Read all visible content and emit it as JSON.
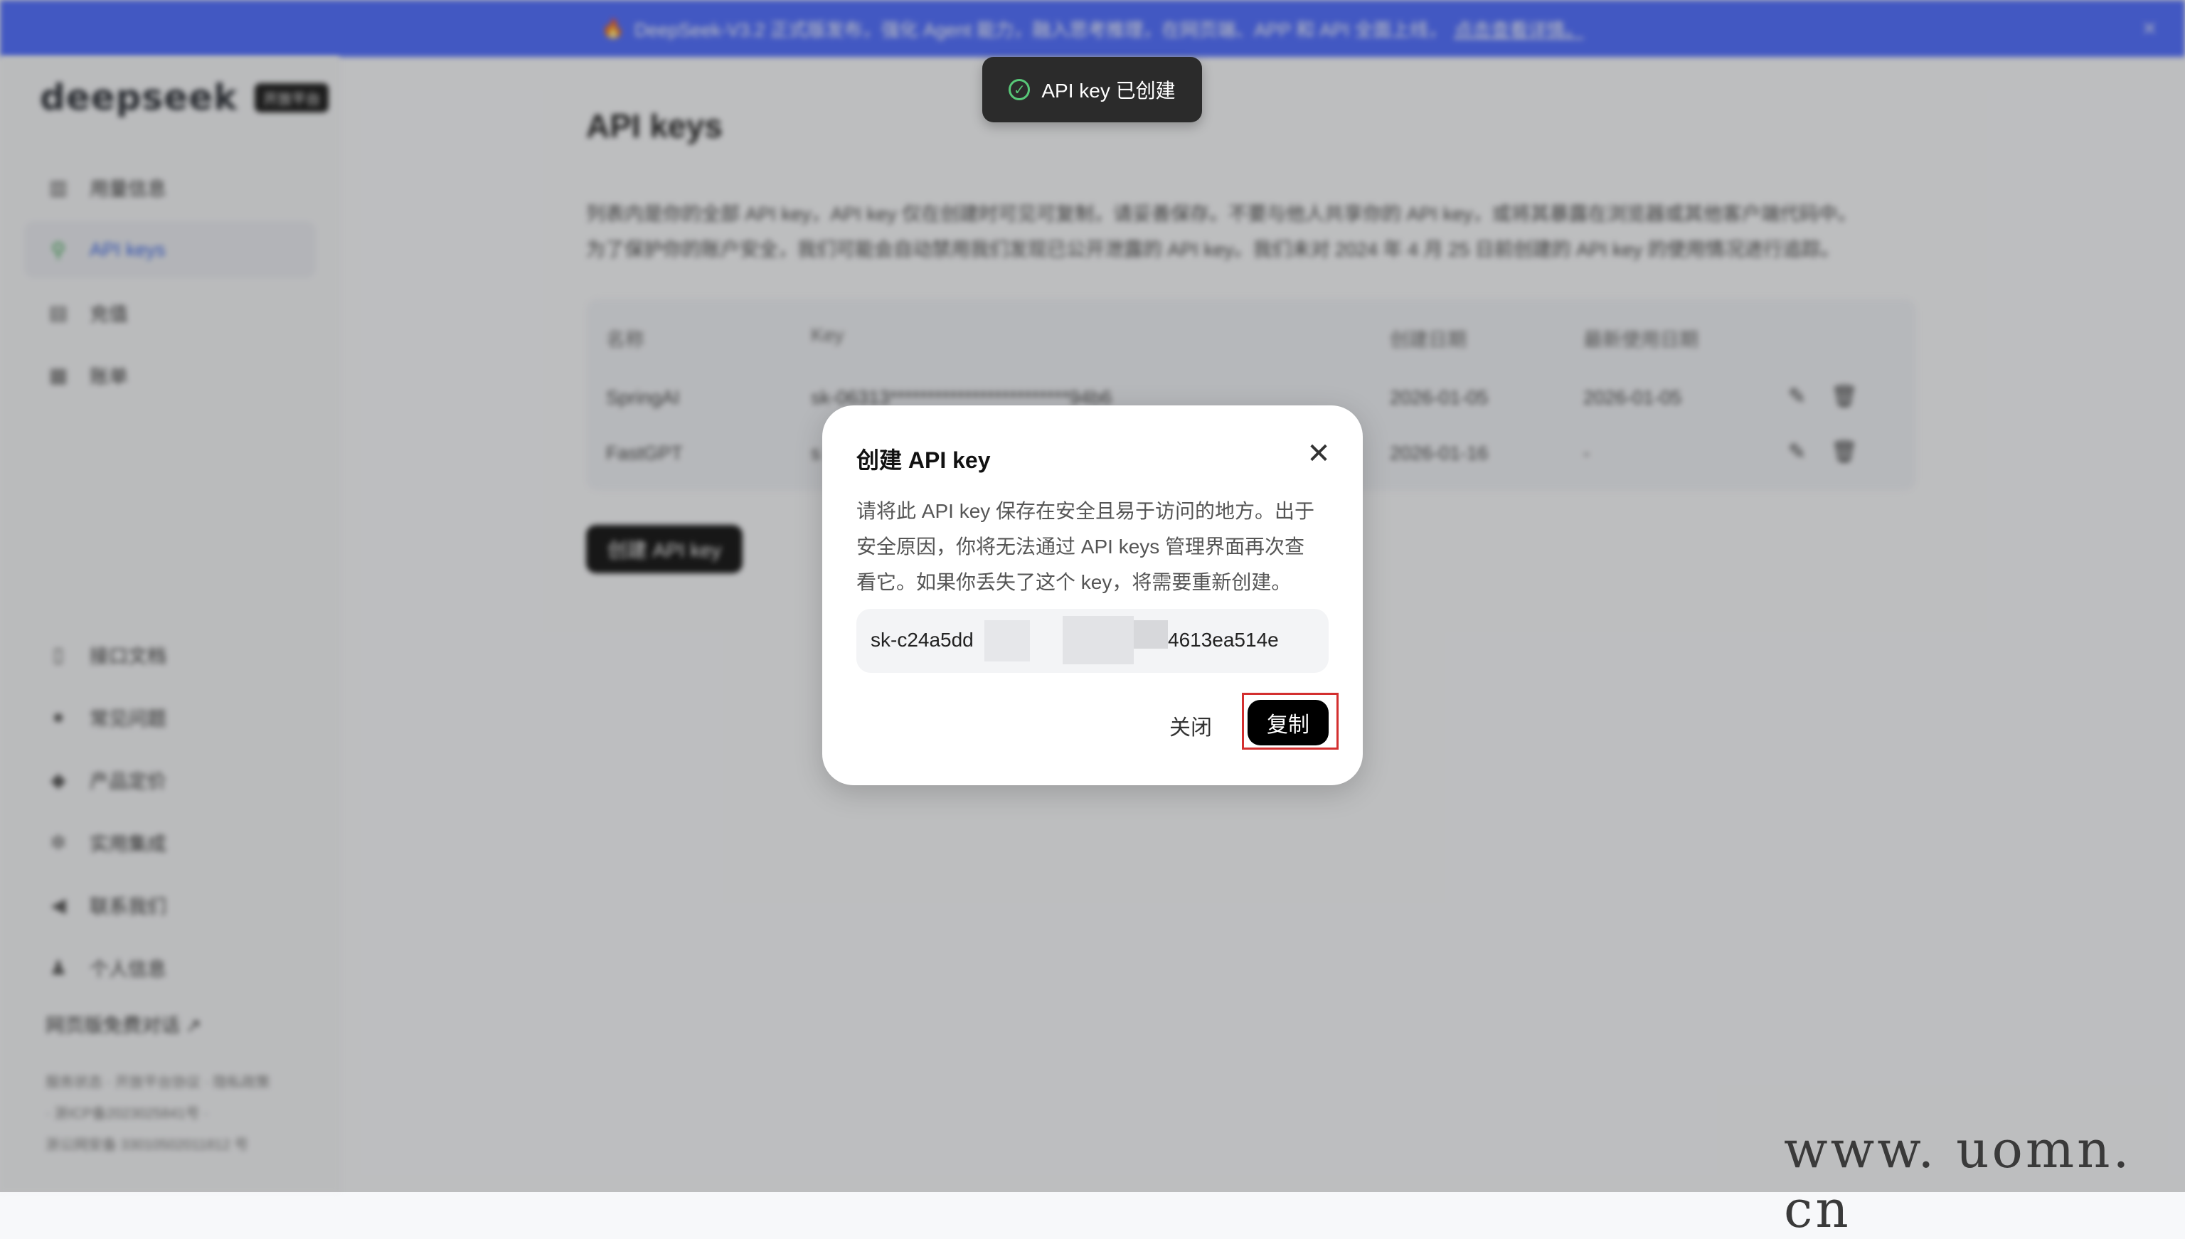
{
  "banner": {
    "text": "DeepSeek-V3.2 正式版发布，强化 Agent 能力，融入思考推理，在网页端、APP 和 API 全面上线，",
    "link": "点击查看详情。"
  },
  "sidebar": {
    "logo": "deepseek",
    "badge": "开放平台",
    "items": [
      {
        "label": "用量信息"
      },
      {
        "label": "API keys"
      },
      {
        "label": "充值"
      },
      {
        "label": "账单"
      }
    ],
    "bottom_items": [
      {
        "label": "接口文档"
      },
      {
        "label": "常见问题"
      },
      {
        "label": "产品定价"
      },
      {
        "label": "实用集成"
      },
      {
        "label": "联系我们"
      },
      {
        "label": "个人信息"
      }
    ],
    "free_chat": "网页版免费对话 ↗",
    "footer": {
      "line1": "服务状态 · 开放平台协议 · 隐私政策",
      "line2": "· 浙ICP备2023025841号 ·",
      "line3": "浙公网安备 33010502011812 号"
    }
  },
  "main": {
    "title": "API keys",
    "desc1": "列表内是你的全部 API key，API key 仅在创建时可见可复制，请妥善保存。不要与他人共享你的 API key，或将其暴露在浏览器或其他客户端代码中。",
    "desc2": "为了保护你的账户安全，我们可能会自动禁用我们发现已公开泄露的 API key。我们未对 2024 年 4 月 25 日前创建的 API key 的使用情况进行追踪。",
    "table": {
      "headers": {
        "name": "名称",
        "key": "Key",
        "created": "创建日期",
        "last_used": "最新使用日期"
      },
      "rows": [
        {
          "name": "SpringAI",
          "key": "sk-06313************************94b6",
          "created": "2026-01-05",
          "last_used": "2026-01-05"
        },
        {
          "name": "FastGPT",
          "key": "s",
          "created": "2026-01-16",
          "last_used": "-"
        }
      ]
    },
    "create_button": "创建 API key"
  },
  "toast": {
    "text": "API key 已创建"
  },
  "modal": {
    "title": "创建 API key",
    "line1": "请将此 API key 保存在安全且易于访问的地方。出于",
    "line2": "安全原因，你将无法通过 API keys 管理界面再次查",
    "line3": "看它。如果你丢失了这个 key，将需要重新创建。",
    "key_start": "sk-c24a5dd",
    "key_end": "4613ea514e",
    "close_label": "关闭",
    "copy_label": "复制"
  },
  "watermark": "www. uomn. cn"
}
